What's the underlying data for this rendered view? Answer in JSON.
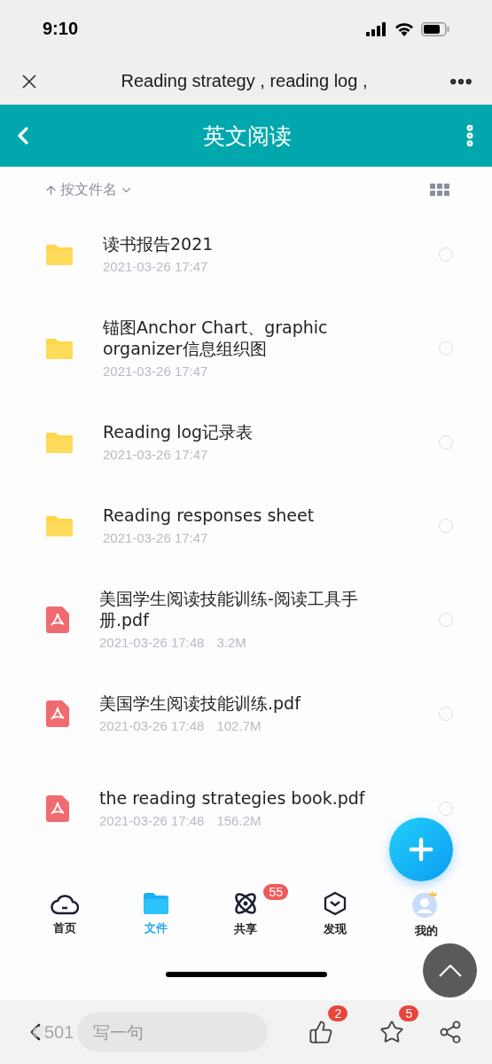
{
  "status_bar": {
    "time": "9:10"
  },
  "browser_bar": {
    "title": "Reading strategy , reading log ,"
  },
  "header": {
    "title": "英文阅读"
  },
  "sort": {
    "label": "按文件名"
  },
  "files": [
    {
      "kind": "folder",
      "name": "读书报告2021",
      "date": "2021-03-26 17:47",
      "selected": false
    },
    {
      "kind": "folder",
      "name": "锚图Anchor Chart、graphic organizer信息组织图",
      "date": "2021-03-26 17:47",
      "selected": false
    },
    {
      "kind": "folder",
      "name": "Reading log记录表",
      "date": "2021-03-26 17:47",
      "selected": false
    },
    {
      "kind": "folder",
      "name": "Reading responses sheet",
      "date": "2021-03-26 17:47",
      "selected": false
    },
    {
      "kind": "pdf",
      "name": "美国学生阅读技能训练-阅读工具手册.pdf",
      "date": "2021-03-26 17:48",
      "size": "3.2M",
      "selected": false
    },
    {
      "kind": "pdf",
      "name": "美国学生阅读技能训练.pdf",
      "date": "2021-03-26 17:48",
      "size": "102.7M",
      "selected": false
    },
    {
      "kind": "pdf",
      "name": "the reading strategies book.pdf",
      "date": "2021-03-26 17:48",
      "size": "156.2M",
      "selected": false
    }
  ],
  "tabs": [
    {
      "kind": "home",
      "label": "首页",
      "selected": false
    },
    {
      "kind": "files",
      "label": "文件",
      "selected": true
    },
    {
      "kind": "share",
      "label": "共享",
      "selected": false,
      "badge": "55"
    },
    {
      "kind": "discover",
      "label": "发现",
      "selected": false
    },
    {
      "kind": "me",
      "label": "我的",
      "selected": false
    }
  ],
  "bottom_bar": {
    "views": "501",
    "comment": {
      "placeholder": "写一句"
    },
    "likes": "2",
    "favorites": "5"
  }
}
